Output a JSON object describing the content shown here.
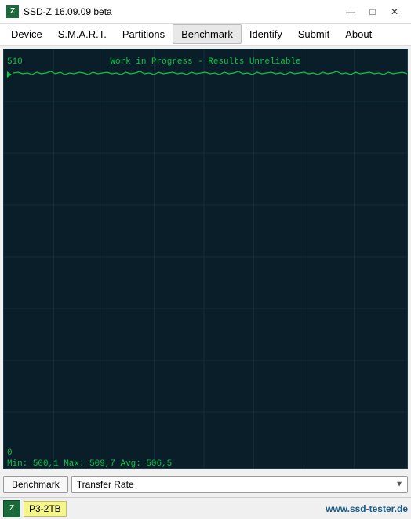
{
  "titleBar": {
    "icon": "Z",
    "title": "SSD-Z 16.09.09 beta",
    "minimize": "—",
    "maximize": "□",
    "close": "✕"
  },
  "menuBar": {
    "items": [
      {
        "id": "device",
        "label": "Device"
      },
      {
        "id": "smart",
        "label": "S.M.A.R.T."
      },
      {
        "id": "partitions",
        "label": "Partitions"
      },
      {
        "id": "benchmark",
        "label": "Benchmark",
        "active": true
      },
      {
        "id": "identify",
        "label": "Identify"
      },
      {
        "id": "submit",
        "label": "Submit"
      },
      {
        "id": "about",
        "label": "About"
      }
    ]
  },
  "chart": {
    "yMax": "510",
    "yMin": "0",
    "title": "Work in Progress - Results Unreliable",
    "stats": "Min: 500,1  Max: 509,7  Avg: 506,5"
  },
  "bottomControls": {
    "benchmarkLabel": "Benchmark",
    "selectOptions": [
      "Transfer Rate"
    ],
    "selectValue": "Transfer Rate"
  },
  "statusBar": {
    "iconLabel": "Z",
    "driveName": "P3-2TB",
    "url": "www.ssd-tester.de"
  }
}
